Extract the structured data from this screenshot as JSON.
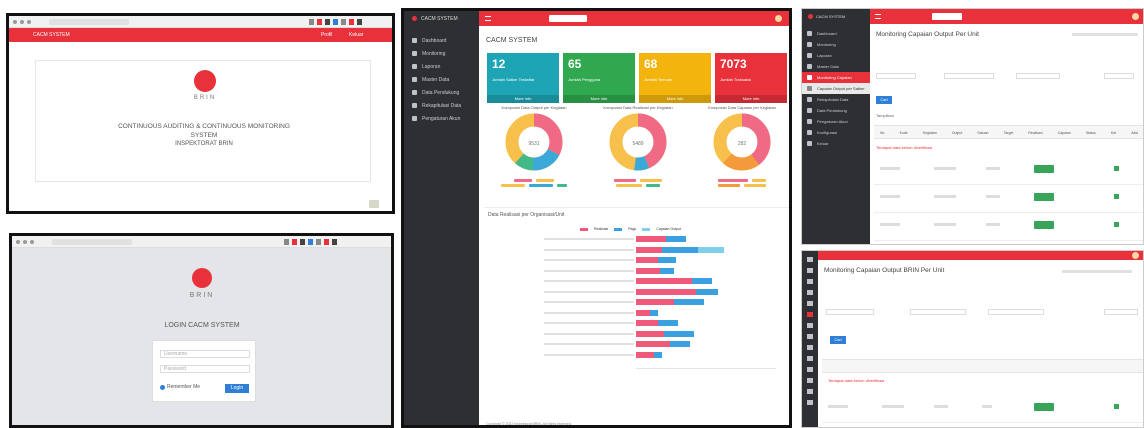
{
  "login_splash": {
    "header_title": "CACM SYSTEM",
    "header_links": [
      "Profil",
      "Keluar"
    ],
    "brand": "BRIN",
    "headline_1": "CONTINUOUS AUDITING & CONTINUOUS MONITORING",
    "headline_2": "SYSTEM",
    "headline_3": "INSPEKTORAT BRIN"
  },
  "login_form": {
    "brand": "BRIN",
    "title": "LOGIN CACM SYSTEM",
    "username_placeholder": "Username",
    "password_placeholder": "Password",
    "remember_label": "Remember Me",
    "login_button": "Login"
  },
  "dashboard": {
    "sidebar_brand": "CACM SYSTEM",
    "sidebar_items": [
      "Dashboard",
      "Monitoring",
      "Laporan",
      "Master Data",
      "Data Pendukung",
      "Rekapitulasi Data",
      "Pengaturan Akun"
    ],
    "page_title": "CACM SYSTEM",
    "stats": [
      {
        "value": "12",
        "label": "Jumlah Satker Terdaftar",
        "more": "More info",
        "color": "#1ea5b5"
      },
      {
        "value": "65",
        "label": "Jumlah Pengguna",
        "more": "More info",
        "color": "#2fa84f"
      },
      {
        "value": "68",
        "label": "Jumlah Temuan",
        "more": "More info",
        "color": "#f3b40e"
      },
      {
        "value": "7073",
        "label": "Jumlah Transaksi",
        "more": "More info",
        "color": "#e8313b"
      }
    ],
    "donuts": [
      {
        "title": "Komposisi Data Output per Kegiatan",
        "center": "9531"
      },
      {
        "title": "Komposisi Data Realisasi per Kegiatan",
        "center": "5489"
      },
      {
        "title": "Komposisi Data Capaian per Kegiatan",
        "center": "282"
      }
    ],
    "hbar_title": "Data Realisasi per Organisasi/Unit",
    "hbar_legend": [
      "Realisasi",
      "Pagu",
      "Capaian Output"
    ],
    "footer": "Copyright © 2022 Inspektorat BRIN. All rights reserved."
  },
  "monitor_top": {
    "sidebar_brand": "CACM SYSTEM",
    "sidebar_items": [
      "Dashboard",
      "Monitoring",
      "Laporan",
      "Master Data",
      "Monitoring Capaian",
      "Capaian Output per Satker",
      "Rekapitulasi Data",
      "Data Pendukung",
      "Pengaturan Akun",
      "Konfigurasi",
      "Keluar"
    ],
    "page_title": "Monitoring Capaian Output Per Unit",
    "search_button": "Cari",
    "section_label": "Tampilkan",
    "table_headers": [
      "No",
      "Kode",
      "Kegiatan",
      "Output",
      "Satuan",
      "Target",
      "Realisasi",
      "Capaian",
      "Status",
      "Ket",
      "Aksi"
    ],
    "alert_text": "Terdapat data belum diverifikasi"
  },
  "monitor_bottom": {
    "page_title": "Monitoring Capaian Output BRIN Per Unit",
    "search_button": "Cari",
    "alert_text": "Terdapat data belum diverifikasi"
  }
}
